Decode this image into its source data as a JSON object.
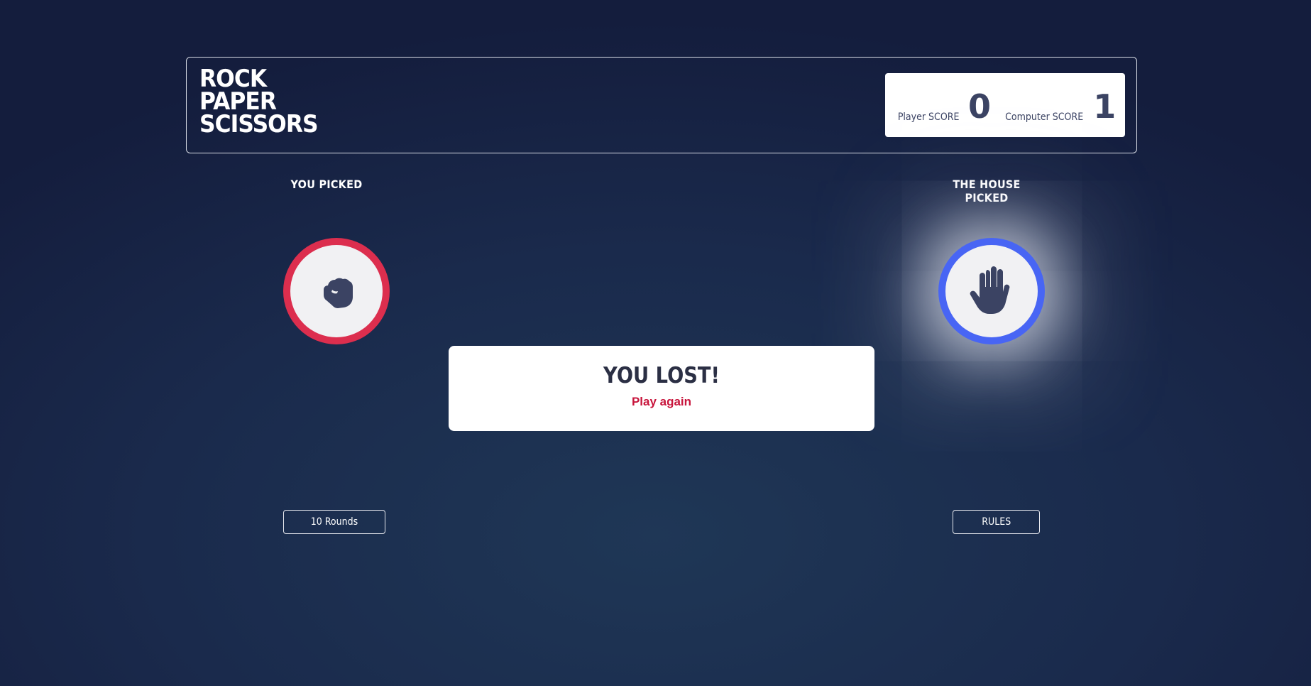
{
  "header": {
    "title_lines": [
      "ROCK",
      "PAPER",
      "SCISSORS"
    ],
    "player_score_label": "Player SCORE",
    "player_score": "0",
    "computer_score_label": "Computer SCORE",
    "computer_score": "1"
  },
  "game": {
    "you_picked_label": "YOU PICKED",
    "house_picked_label": "THE HOUSE PICKED",
    "player_choice": "rock-icon",
    "house_choice": "paper-icon",
    "result_text": "YOU LOST!",
    "play_again_label": "Play again"
  },
  "footer": {
    "rounds_label": "10 Rounds",
    "rules_label": "RULES"
  },
  "colors": {
    "rock": "#dc2e4e",
    "paper": "#4865f4",
    "icon": "#3b4363",
    "play_again": "#c8153c",
    "background": "#1a2a4c"
  }
}
